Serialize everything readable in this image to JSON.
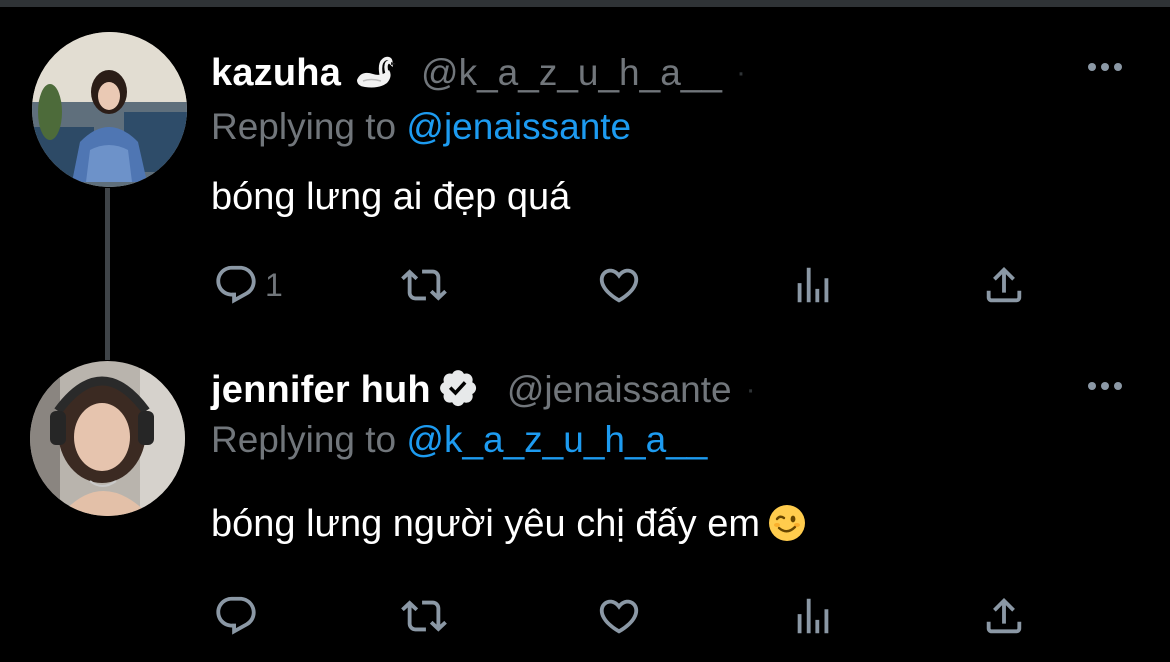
{
  "theme": {
    "background": "#000000",
    "text_primary": "#ffffff",
    "text_secondary": "#71767b",
    "link": "#1d9bf0",
    "thread_line": "#3f4448"
  },
  "tweets": [
    {
      "display_name": "kazuha",
      "name_emoji": "swan-emoji",
      "handle": "@k_a_z_u_h_a__",
      "replying_prefix": "Replying to",
      "replying_to": "@jenaissante",
      "text": "bóng lưng ai đẹp quá",
      "reply_count": "1",
      "icons": [
        "reply-icon",
        "retweet-icon",
        "like-icon",
        "views-icon",
        "share-icon",
        "more-icon"
      ]
    },
    {
      "display_name": "jennifer huh",
      "verified": true,
      "handle": "@jenaissante",
      "replying_prefix": "Replying to",
      "replying_to": "@k_a_z_u_h_a__",
      "text": "bóng lưng người yêu chị đấy em",
      "text_emoji": "wink-emoji",
      "reply_count": "",
      "icons": [
        "reply-icon",
        "retweet-icon",
        "like-icon",
        "views-icon",
        "share-icon",
        "more-icon"
      ]
    }
  ]
}
